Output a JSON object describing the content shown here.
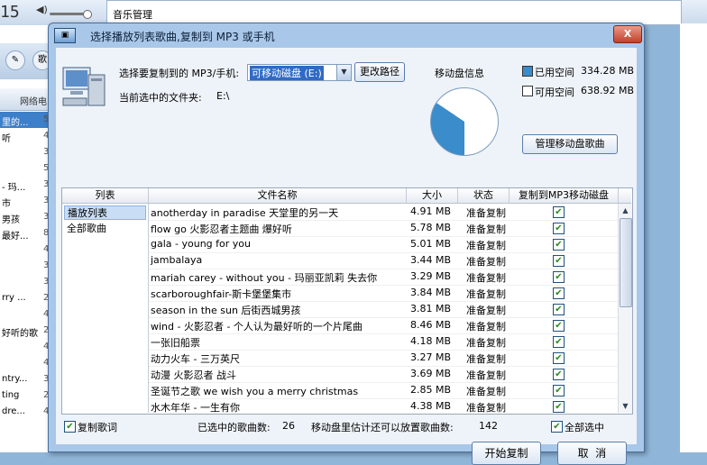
{
  "background": {
    "clock": "15",
    "window_title": "音乐管理",
    "tab_label": "网络电",
    "rows": [
      {
        "a": "里的...",
        "b": "5",
        "selected": true
      },
      {
        "a": "听",
        "b": "4"
      },
      {
        "a": "",
        "b": "3"
      },
      {
        "a": "",
        "b": "5"
      },
      {
        "a": "- 玛...",
        "b": "3"
      },
      {
        "a": "市",
        "b": "3"
      },
      {
        "a": "男孩",
        "b": "3"
      },
      {
        "a": "最好...",
        "b": "8"
      },
      {
        "a": "",
        "b": "4"
      },
      {
        "a": "",
        "b": "3"
      },
      {
        "a": "",
        "b": "3"
      },
      {
        "a": "rry ...",
        "b": "2"
      },
      {
        "a": "",
        "b": "4"
      },
      {
        "a": "好听的歌",
        "b": "2"
      },
      {
        "a": "",
        "b": "4"
      },
      {
        "a": "",
        "b": "4"
      },
      {
        "a": "ntry...",
        "b": "3"
      },
      {
        "a": "ting",
        "b": "2"
      },
      {
        "a": "dre...",
        "b": "4"
      }
    ]
  },
  "dialog": {
    "title": "选择播放列表歌曲,复制到 MP3 或手机",
    "close_label": "X",
    "target_label": "选择要复制到的 MP3/手机:",
    "device_value": "可移动磁盘 (E:)",
    "change_path_label": "更改路径",
    "current_folder_label": "当前选中的文件夹:",
    "current_folder_value": "E:\\",
    "disk_info_label": "移动盘信息",
    "used_label": "已用空间",
    "used_value": "334.28 MB",
    "free_label": "可用空间",
    "free_value": "638.92 MB",
    "used_color": "#3a8ccb",
    "free_color": "#ffffff",
    "used_fraction": 0.3435,
    "manage_button": "管理移动盘歌曲",
    "columns": {
      "list": "列表",
      "name": "文件名称",
      "size": "大小",
      "status": "状态",
      "copy": "复制到MP3移动磁盘"
    },
    "lists": [
      {
        "label": "播放列表",
        "selected": true
      },
      {
        "label": "全部歌曲",
        "selected": false
      }
    ],
    "songs": [
      {
        "name": "anotherday in paradise 天堂里的另一天",
        "size": "4.91 MB",
        "status": "准备复制"
      },
      {
        "name": "flow go 火影忍者主题曲 爆好听",
        "size": "5.78 MB",
        "status": "准备复制"
      },
      {
        "name": "gala - young for you",
        "size": "5.01 MB",
        "status": "准备复制"
      },
      {
        "name": "jambalaya",
        "size": "3.44 MB",
        "status": "准备复制"
      },
      {
        "name": "mariah carey - without you - 玛丽亚凯莉 失去你",
        "size": "3.29 MB",
        "status": "准备复制"
      },
      {
        "name": "scarboroughfair-斯卡堡堡集市",
        "size": "3.84 MB",
        "status": "准备复制"
      },
      {
        "name": "season in the sun 后街西城男孩",
        "size": "3.81 MB",
        "status": "准备复制"
      },
      {
        "name": "wind - 火影忍者 - 个人认为最好听的一个片尾曲",
        "size": "8.46 MB",
        "status": "准备复制"
      },
      {
        "name": "一张旧船票",
        "size": "4.18 MB",
        "status": "准备复制"
      },
      {
        "name": "动力火车 - 三万英尺",
        "size": "3.27 MB",
        "status": "准备复制"
      },
      {
        "name": "动漫 火影忍者 战斗",
        "size": "3.69 MB",
        "status": "准备复制"
      },
      {
        "name": "圣诞节之歌 we wish you a merry christmas",
        "size": "2.85 MB",
        "status": "准备复制"
      },
      {
        "name": "水木年华 - 一生有你",
        "size": "4.38 MB",
        "status": "准备复制"
      }
    ],
    "copy_lyrics_label": "复制歌词",
    "selected_count_label": "已选中的歌曲数:",
    "selected_count": "26",
    "capacity_label": "移动盘里估计还可以放置歌曲数:",
    "capacity_count": "142",
    "select_all_label": "全部选中",
    "start_copy_button": "开始复制",
    "cancel_button": "取  消"
  }
}
